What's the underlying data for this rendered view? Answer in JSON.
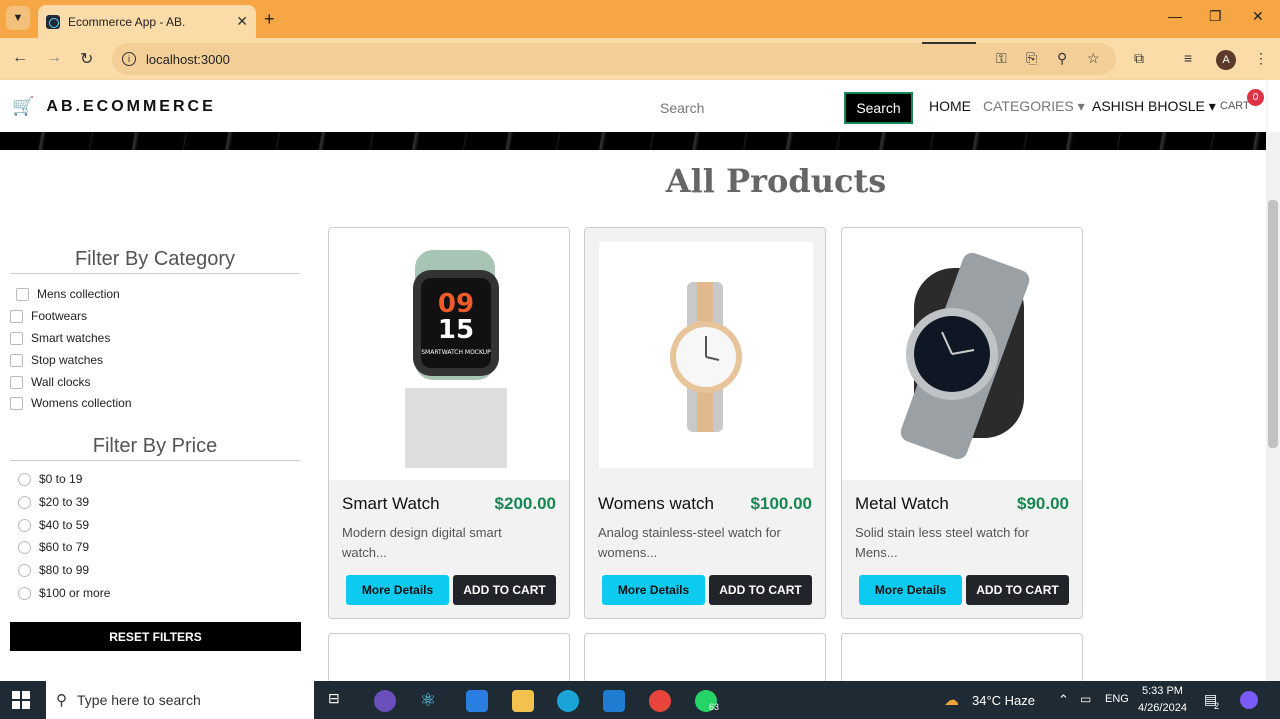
{
  "browser": {
    "tab_title": "Ecommerce App - AB.",
    "url": "localhost:3000",
    "profile_initial": "A"
  },
  "site": {
    "brand": "AB.ECOMMERCE",
    "search_placeholder": "Search",
    "search_button": "Search",
    "nav": {
      "home": "HOME",
      "categories": "CATEGORIES ▾",
      "user": "ASHISH BHOSLE ▾",
      "cart": "CART",
      "cart_count": "0"
    }
  },
  "main": {
    "heading": "All Products",
    "filter_category_title": "Filter By Category",
    "categories": [
      "Mens collection",
      "Footwears",
      "Smart watches",
      "Stop watches",
      "Wall clocks",
      "Womens collection"
    ],
    "filter_price_title": "Filter By Price",
    "prices": [
      "$0 to 19",
      "$20 to 39",
      "$40 to 59",
      "$60 to 79",
      "$80 to 99",
      "$100 or more"
    ],
    "reset_button": "RESET FILTERS",
    "products": [
      {
        "name": "Smart Watch",
        "price": "$200.00",
        "desc": "Modern design digital smart watch...",
        "more": "More Details",
        "add": "ADD TO CART",
        "watch_face_top": "09",
        "watch_face_bottom": "15",
        "watch_face_caption": "SMARTWATCH MOCKUP"
      },
      {
        "name": "Womens watch",
        "price": "$100.00",
        "desc": "Analog stainless-steel watch for womens...",
        "more": "More Details",
        "add": "ADD TO CART"
      },
      {
        "name": "Metal Watch",
        "price": "$90.00",
        "desc": "Solid stain less steel watch for Mens...",
        "more": "More Details",
        "add": "ADD TO CART"
      }
    ]
  },
  "taskbar": {
    "search_text": "Type here to search",
    "weather": "34°C  Haze",
    "lang": "ENG",
    "time": "5:33 PM",
    "date": "4/26/2024",
    "whatsapp_badge": "63",
    "notif_count": "2"
  },
  "colors": {
    "tabbar": "#f7a645",
    "price_green": "#198754",
    "more_btn": "#0dcaf0",
    "cart_badge": "#dc3545"
  }
}
